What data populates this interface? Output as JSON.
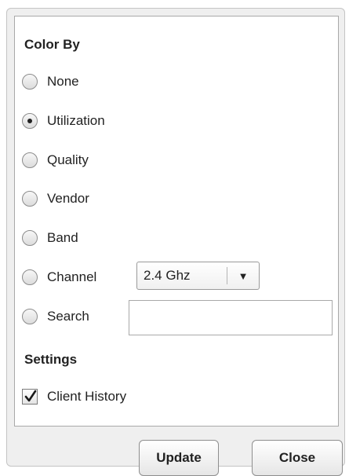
{
  "color_by": {
    "title": "Color By",
    "options": [
      {
        "label": "None",
        "selected": false
      },
      {
        "label": "Utilization",
        "selected": true
      },
      {
        "label": "Quality",
        "selected": false
      },
      {
        "label": "Vendor",
        "selected": false
      },
      {
        "label": "Band",
        "selected": false
      },
      {
        "label": "Channel",
        "selected": false
      },
      {
        "label": "Search",
        "selected": false
      }
    ],
    "channel_select": {
      "value": "2.4 Ghz",
      "icon": "dropdown-arrow-icon"
    },
    "search_value": ""
  },
  "settings": {
    "title": "Settings",
    "client_history": {
      "label": "Client History",
      "checked": true
    }
  },
  "buttons": {
    "update": "Update",
    "close": "Close"
  }
}
